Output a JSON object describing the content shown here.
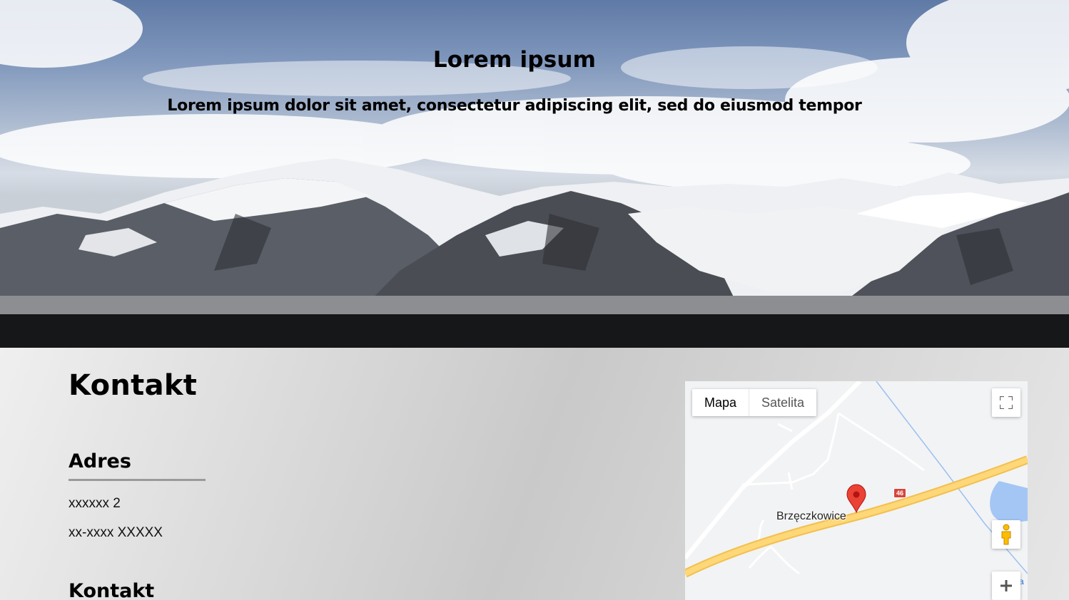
{
  "hero": {
    "title": "Lorem ipsum",
    "subtitle": "Lorem ipsum dolor sit amet, consectetur adipiscing elit, sed do eiusmod tempor"
  },
  "contact": {
    "title": "Kontakt",
    "address_heading": "Adres",
    "address_lines": [
      "xxxxxx 2",
      "xx-xxxx XXXXX"
    ],
    "contact_heading": "Kontakt"
  },
  "map": {
    "map_types": [
      "Mapa",
      "Satelita"
    ],
    "selected_map_type": "Mapa",
    "place_label": "Brzęczkowice",
    "road_number": "46",
    "partial_text": "a l",
    "controls": [
      "fullscreen-icon",
      "pegman-icon",
      "zoom-in-icon"
    ],
    "colors": {
      "road": "#fdd778",
      "road_edge": "#f1c04f",
      "water": "#a4c6f5",
      "marker": "#ea4335",
      "background": "#f2f3f4"
    }
  }
}
